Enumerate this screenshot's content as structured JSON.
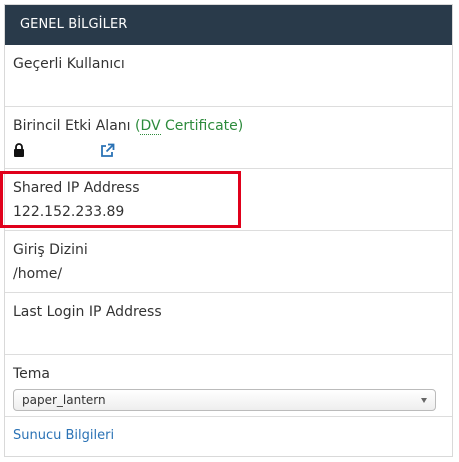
{
  "panel": {
    "title": "GENEL BİLGİLER"
  },
  "current_user": {
    "label": "Geçerli Kullanıcı",
    "value": ""
  },
  "primary_domain": {
    "label": "Birincil Etki Alanı",
    "cert_open": "(",
    "cert_link": "DV",
    "cert_rest": " Certificate)",
    "icons": [
      "lock-icon",
      "external-link-icon"
    ]
  },
  "shared_ip": {
    "label": "Shared IP Address",
    "value": "122.152.233.89"
  },
  "home_dir": {
    "label": "Giriş Dizini",
    "value": "/home/"
  },
  "last_login": {
    "label": "Last Login IP Address",
    "value": ""
  },
  "theme": {
    "label": "Tema",
    "selected": "paper_lantern"
  },
  "server_info": {
    "link": "Sunucu Bilgileri"
  },
  "colors": {
    "header_bg": "#293a4a",
    "highlight": "#e0001b",
    "link": "#2a72b5",
    "cert_green": "#2d8b3c"
  }
}
